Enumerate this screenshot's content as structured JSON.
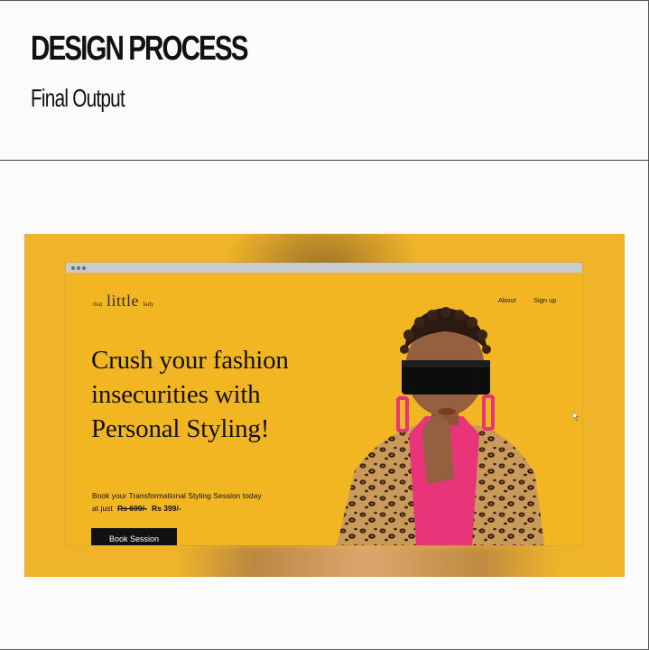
{
  "header": {
    "title": "DESIGN PROCESS",
    "subtitle": "Final Output"
  },
  "site": {
    "logo": {
      "prefix": "that",
      "main": "little",
      "suffix": "lady"
    },
    "nav": [
      "About",
      "Sign up"
    ],
    "hero": {
      "title_lines": [
        "Crush your fashion",
        "insecurities with",
        "Personal Styling!"
      ],
      "subtitle": "Book your Transformational Styling Session today",
      "price_prefix": "at just",
      "price_old": "Rs 699/-",
      "price_new": "Rs 399/-",
      "cta": "Book Session"
    }
  },
  "colors": {
    "accent_yellow": "#f2b623",
    "button_dark": "#111111",
    "pink": "#e8357a",
    "browser_bar": "#c9cbd0"
  },
  "icons": {
    "window_dots": "three-dots-icon",
    "cursor": "mouse-cursor-icon"
  }
}
